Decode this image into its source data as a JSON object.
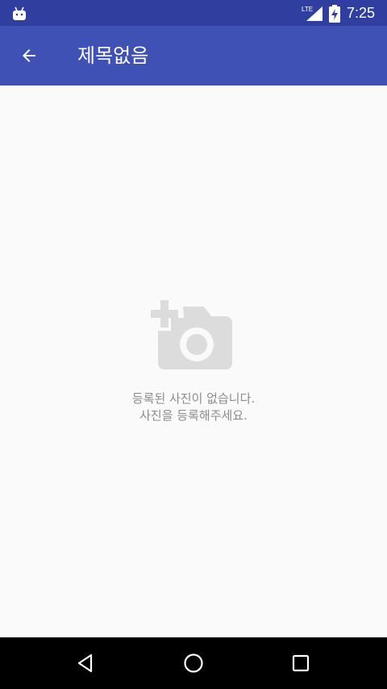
{
  "status_bar": {
    "time": "7:25",
    "network_label": "LTE",
    "icons": [
      "android-icon",
      "lte-signal-icon",
      "battery-charging-icon"
    ]
  },
  "app_bar": {
    "title": "제목없음",
    "back_icon": "arrow-back-icon"
  },
  "empty_state": {
    "icon": "add-photo-camera-icon",
    "line1": "등록된 사진이 없습니다.",
    "line2": "사진을 등록해주세요."
  },
  "nav_bar": {
    "icons": [
      "nav-back-icon",
      "nav-home-icon",
      "nav-recents-icon"
    ]
  },
  "colors": {
    "status_bar": "#303f9f",
    "app_bar": "#3f51b5",
    "background": "#fafafa",
    "empty_icon": "#dcdcdc",
    "empty_text": "#8c8c8c",
    "nav_bar": "#000000"
  }
}
